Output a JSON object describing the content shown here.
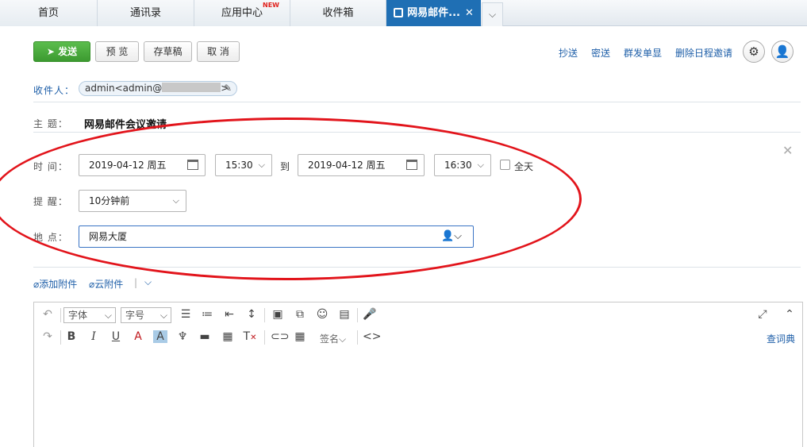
{
  "tabs": [
    {
      "label": "首页"
    },
    {
      "label": "通讯录"
    },
    {
      "label": "应用中心",
      "badge": "NEW"
    },
    {
      "label": "收件箱"
    },
    {
      "label": "网易邮件..."
    }
  ],
  "toolbar": {
    "send": "发送",
    "preview": "预 览",
    "draft": "存草稿",
    "cancel": "取 消",
    "cc": "抄送",
    "bcc": "密送",
    "separate": "群发单显",
    "delete_schedule": "删除日程邀请"
  },
  "recipient": {
    "label": "收件人：",
    "value_prefix": "admin<admin@",
    "value_suffix": ">"
  },
  "subject": {
    "label": "主 题：",
    "value": "网易邮件会议邀请"
  },
  "schedule": {
    "time_label": "时 间：",
    "start_date": "2019-04-12 周五",
    "start_time": "15:30",
    "to": "到",
    "end_date": "2019-04-12 周五",
    "end_time": "16:30",
    "all_day": "全天",
    "reminder_label": "提 醒：",
    "reminder": "10分钟前",
    "location_label": "地 点：",
    "location": "网易大厦"
  },
  "attachments": {
    "add": "添加附件",
    "cloud": "云附件"
  },
  "editor": {
    "font": "字体",
    "size": "字号",
    "signature": "签名",
    "dictionary": "查词典"
  },
  "colors": {
    "tab_active": "#1f6fb4",
    "send_green": "#44a536",
    "link_blue": "#1d5ea8",
    "annotation_red": "#e2141b"
  }
}
